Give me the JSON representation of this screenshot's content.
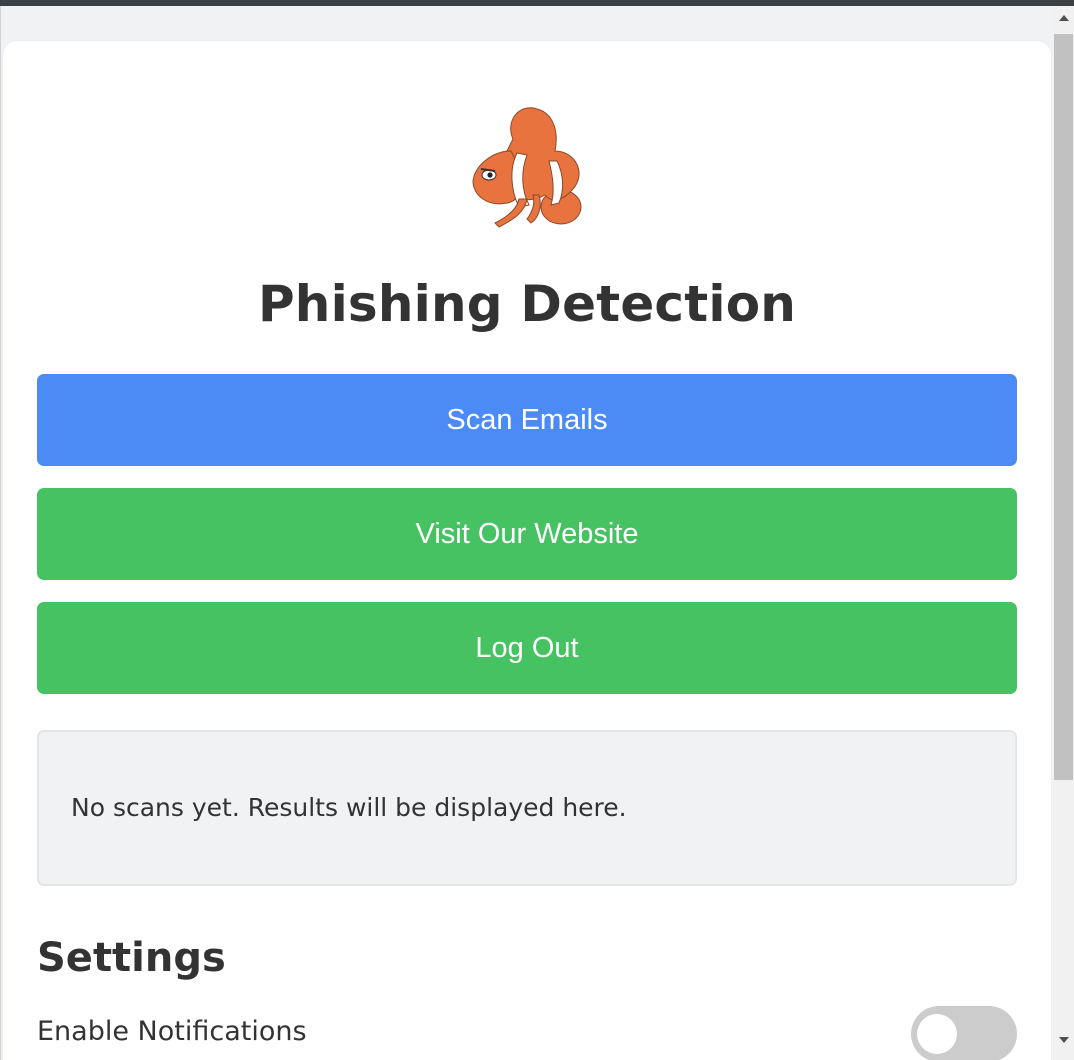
{
  "header": {
    "logo_icon": "clownfish-logo-icon",
    "title": "Phishing Detection"
  },
  "actions": {
    "scan_label": "Scan Emails",
    "visit_label": "Visit Our Website",
    "logout_label": "Log Out"
  },
  "results": {
    "message": "No scans yet. Results will be displayed here."
  },
  "settings": {
    "heading": "Settings",
    "notifications_label": "Enable Notifications",
    "notifications_enabled": false
  },
  "colors": {
    "scan_button": "#4c8bf5",
    "action_button": "#46c262",
    "toggle_off": "#cccccc",
    "text": "#333333"
  },
  "scrollbar": {
    "up_icon": "scroll-up-arrow-icon",
    "down_icon": "scroll-down-arrow-icon"
  }
}
